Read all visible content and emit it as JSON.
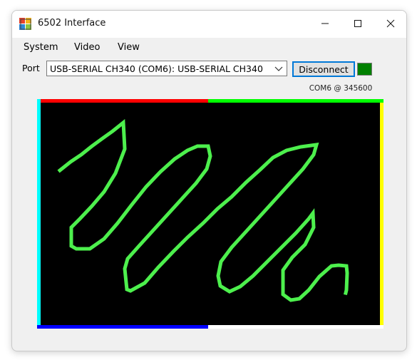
{
  "window": {
    "title": "6502 Interface",
    "icon": "app-icon",
    "controls": [
      "minimize-icon",
      "maximize-icon",
      "close-icon"
    ]
  },
  "menu": {
    "items": [
      "System",
      "Video",
      "View"
    ]
  },
  "port": {
    "label": "Port",
    "selected": "USB-SERIAL CH340 (COM6): USB-SERIAL CH340"
  },
  "connection": {
    "button_label": "Disconnect",
    "status_text": "COM6 @ 345600",
    "led_color": "#008000"
  },
  "screen": {
    "background": "#000000",
    "stroke_color": "#4df04d",
    "frame_colors": {
      "top_left": "#ff0000",
      "top_right": "#00ff00",
      "left": "#00ffff",
      "right": "#ffff00",
      "bottom_left": "#0000ff",
      "bottom_right": "#ffffff"
    }
  }
}
